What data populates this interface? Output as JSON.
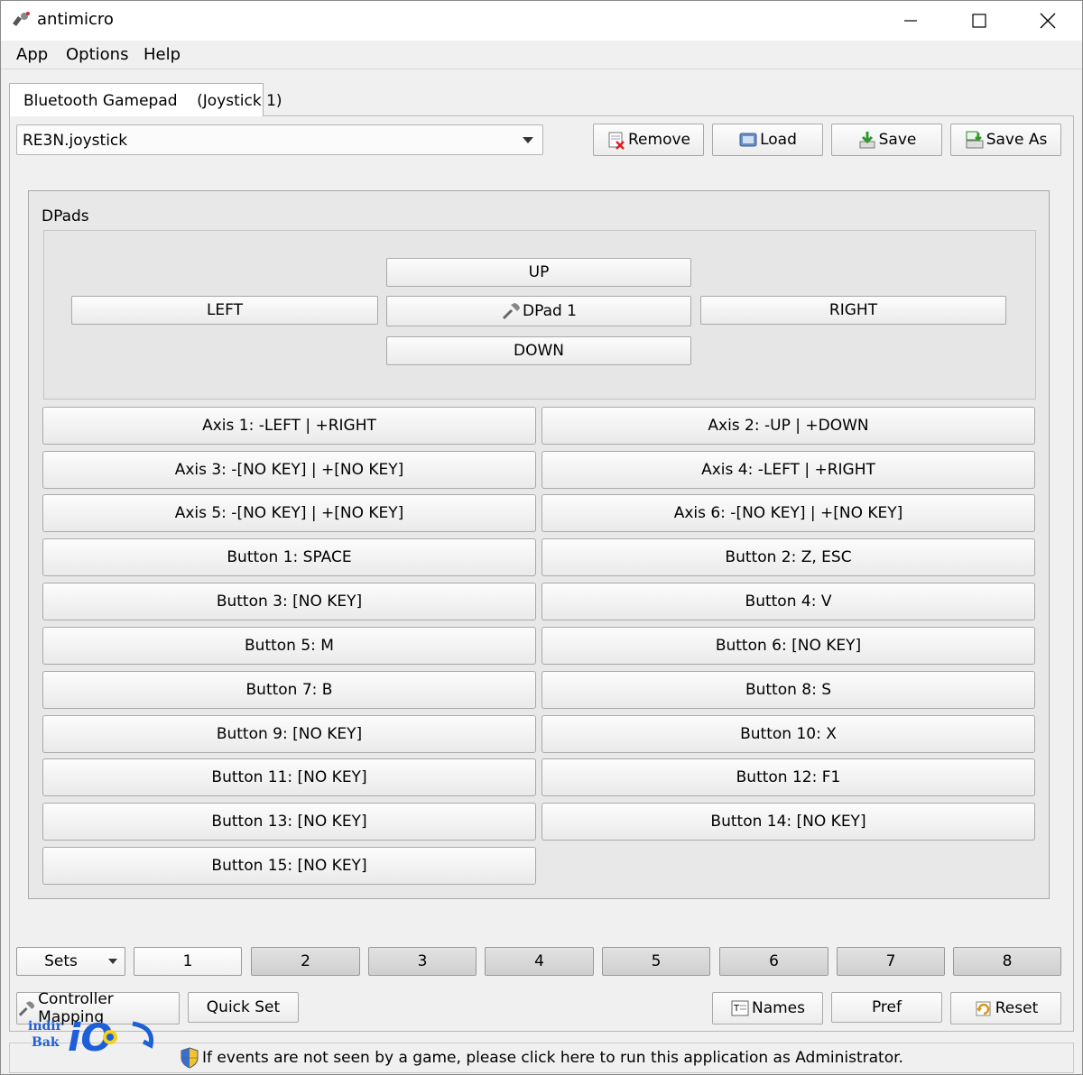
{
  "window": {
    "title": "antimicro"
  },
  "menu": {
    "app": "App",
    "options": "Options",
    "help": "Help"
  },
  "tab": {
    "label": "Bluetooth Gamepad    (Joystick 1)"
  },
  "profile": {
    "selected": "RE3N.joystick"
  },
  "toolbar": {
    "remove": "Remove",
    "load": "Load",
    "save": "Save",
    "save_as": "Save As"
  },
  "dpads": {
    "title": "DPads",
    "up": "UP",
    "left": "LEFT",
    "center": "DPad 1",
    "right": "RIGHT",
    "down": "DOWN"
  },
  "mappings": [
    "Axis 1: -LEFT | +RIGHT",
    "Axis 2: -UP | +DOWN",
    "Axis 3: -[NO KEY] | +[NO KEY]",
    "Axis 4: -LEFT | +RIGHT",
    "Axis 5: -[NO KEY] | +[NO KEY]",
    "Axis 6: -[NO KEY] | +[NO KEY]",
    "Button 1: SPACE",
    "Button 2: Z, ESC",
    "Button 3: [NO KEY]",
    "Button 4: V",
    "Button 5: M",
    "Button 6: [NO KEY]",
    "Button 7: B",
    "Button 8: S",
    "Button 9: [NO KEY]",
    "Button 10: X",
    "Button 11: [NO KEY]",
    "Button 12: F1",
    "Button 13: [NO KEY]",
    "Button 14: [NO KEY]",
    "Button 15: [NO KEY]"
  ],
  "sets": {
    "label": "Sets",
    "items": [
      "1",
      "2",
      "3",
      "4",
      "5",
      "6",
      "7",
      "8"
    ],
    "active": "1"
  },
  "bottom": {
    "controller_mapping": "Controller Mapping",
    "quick_set": "Quick Set",
    "names": "Names",
    "pref": "Pref",
    "reset": "Reset"
  },
  "status": {
    "message": "If events are not seen by a game, please click here to run this application as Administrator."
  },
  "watermark": {
    "line1": "indir",
    "line2": "Bak",
    "logo": "iO"
  }
}
